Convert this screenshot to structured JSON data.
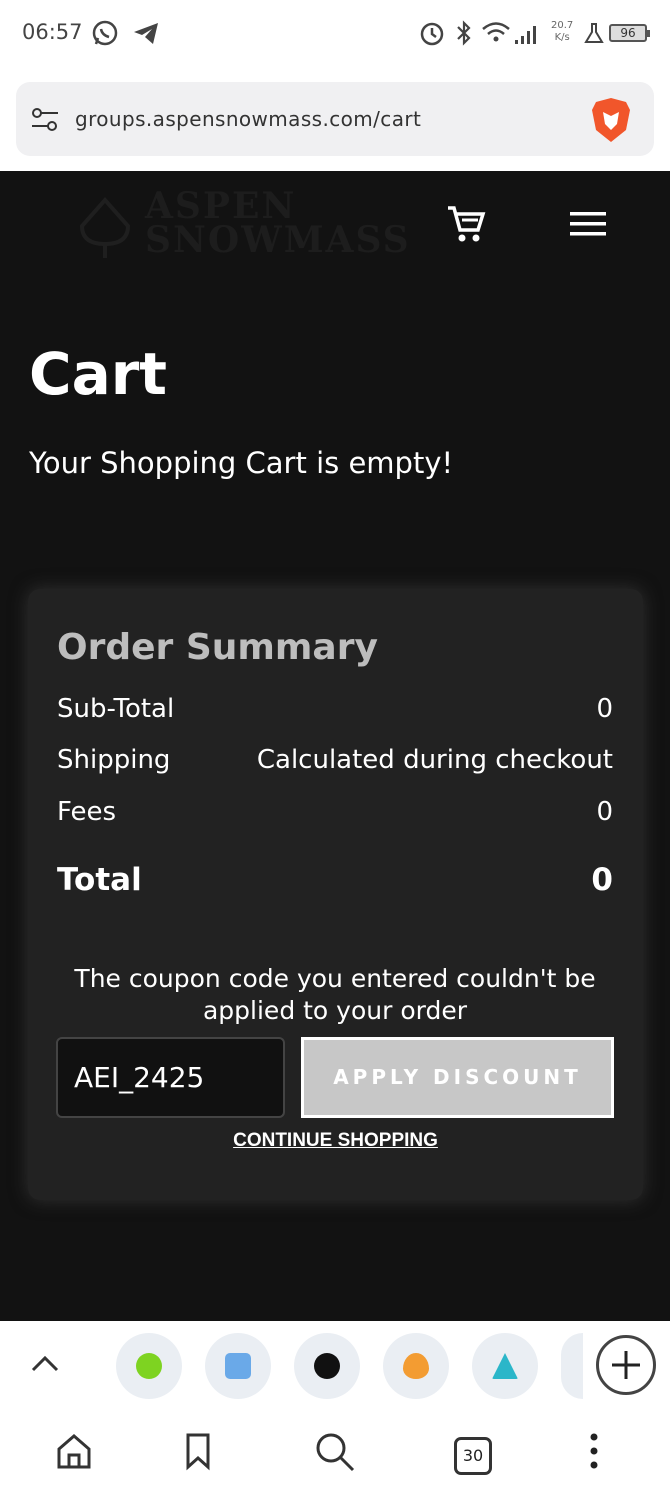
{
  "status_bar": {
    "time": "06:57",
    "speed_value": "20.7",
    "speed_unit": "K/s",
    "battery": "96"
  },
  "browser": {
    "url": "groups.aspensnowmass.com/cart"
  },
  "site": {
    "logo_line1": "ASPEN",
    "logo_line2": "SNOWMASS"
  },
  "page": {
    "title": "Cart",
    "empty_message": "Your Shopping Cart is empty!"
  },
  "summary": {
    "title": "Order Summary",
    "rows": [
      {
        "label": "Sub-Total",
        "value": "0"
      },
      {
        "label": "Shipping",
        "value": "Calculated during checkout"
      },
      {
        "label": "Fees",
        "value": "0"
      }
    ],
    "total_label": "Total",
    "total_value": "0",
    "coupon_message": "The coupon code you entered couldn't be applied to your order",
    "coupon_value": "AEI_2425",
    "apply_label": "APPLY DISCOUNT",
    "continue_label": "CONTINUE SHOPPING"
  },
  "bottom_bar": {
    "tab_count": "30"
  },
  "colors": {
    "page_bg": "#121212",
    "card_bg": "#222222",
    "button_bg": "#c7c7c7",
    "brave_orange": "#f1562b"
  }
}
